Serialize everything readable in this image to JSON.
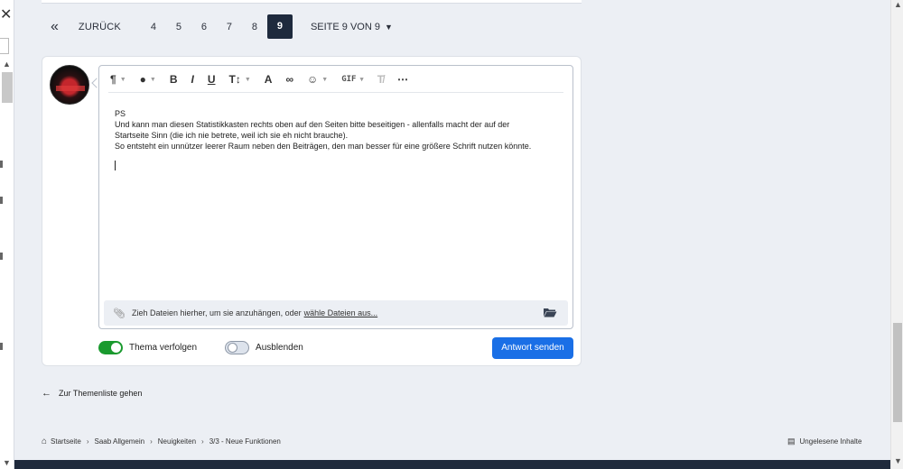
{
  "pagination": {
    "first_icon": "«",
    "back_label": "ZURÜCK",
    "pages": [
      "4",
      "5",
      "6",
      "7",
      "8",
      "9"
    ],
    "active_page": "9",
    "page_of": "SEITE 9 VON 9"
  },
  "editor": {
    "toolbar": {
      "paragraph": "¶",
      "style": "●",
      "bold": "B",
      "italic": "I",
      "underline": "U",
      "textsize": "T↕",
      "font_color": "A",
      "link": "∞",
      "emoji": "☺",
      "gif": "GIF",
      "clear_format": "T̸",
      "more": "⋯"
    },
    "content_lines": [
      "PS",
      "Und kann man diesen Statistikkasten rechts oben auf den Seiten bitte beseitigen - allenfalls macht der auf der",
      "Startseite Sinn (die ich nie betrete, weil ich sie eh nicht brauche).",
      "So entsteht ein unnützer leerer Raum neben den Beiträgen, den man besser für eine größere Schrift nutzen könnte."
    ],
    "attach_text": "Zieh Dateien hierher, um sie anzuhängen, oder",
    "attach_link": "wähle Dateien aus..."
  },
  "options": {
    "follow_label": "Thema verfolgen",
    "follow_on": true,
    "hide_label": "Ausblenden",
    "hide_on": false
  },
  "send_label": "Antwort senden",
  "back_link": "Zur Themenliste gehen",
  "breadcrumb": [
    "Startseite",
    "Saab Allgemein",
    "Neuigkeiten",
    "3/3 - Neue Funktionen"
  ],
  "unread_label": "Ungelesene Inhalte",
  "colors": {
    "primary": "#1a6fe6",
    "dark": "#1e2a3d",
    "toggle_on": "#1a9a2e",
    "background": "#eceff4"
  }
}
